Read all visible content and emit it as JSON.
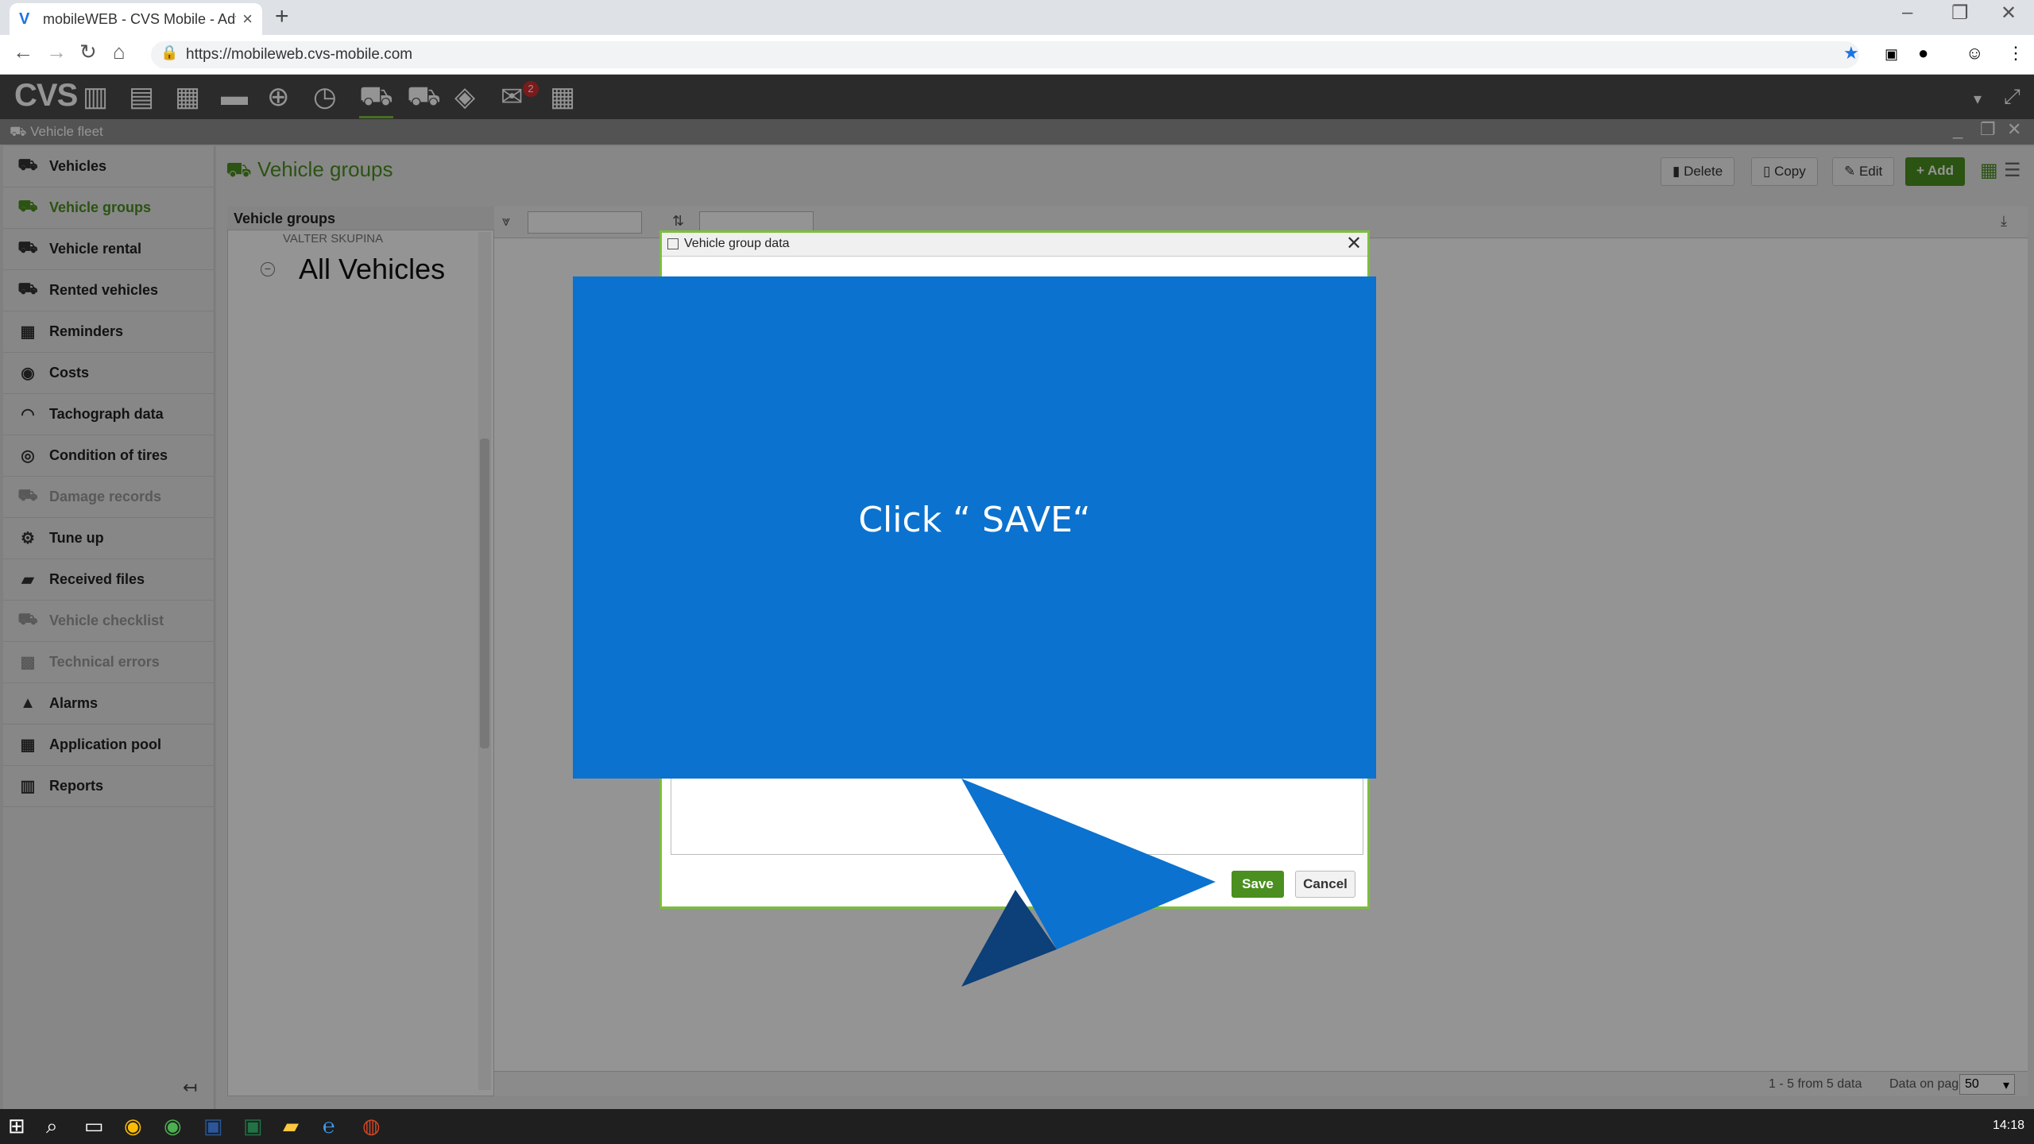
{
  "browser": {
    "tab_title": "mobileWEB - CVS Mobile - Adva",
    "new_tab": "+",
    "url": "https://mobileweb.cvs-mobile.com",
    "window_controls": [
      "–",
      "❐",
      "✕"
    ]
  },
  "app": {
    "logo": "CVS",
    "notification_count": "2",
    "module_title": "Vehicle fleet"
  },
  "sidebar": {
    "items": [
      {
        "label": "Vehicles",
        "icon": "car-icon"
      },
      {
        "label": "Vehicle groups",
        "icon": "vehicle-groups-icon"
      },
      {
        "label": "Vehicle rental",
        "icon": "vehicle-rental-icon"
      },
      {
        "label": "Rented vehicles",
        "icon": "rented-vehicles-icon"
      },
      {
        "label": "Reminders",
        "icon": "calendar-icon"
      },
      {
        "label": "Costs",
        "icon": "coin-icon"
      },
      {
        "label": "Tachograph data",
        "icon": "tachograph-icon"
      },
      {
        "label": "Condition of tires",
        "icon": "tire-icon"
      },
      {
        "label": "Damage records",
        "icon": "damage-icon"
      },
      {
        "label": "Tune up",
        "icon": "tune-up-icon"
      },
      {
        "label": "Received files",
        "icon": "folder-icon"
      },
      {
        "label": "Vehicle checklist",
        "icon": "checklist-icon"
      },
      {
        "label": "Technical errors",
        "icon": "engine-icon"
      },
      {
        "label": "Alarms",
        "icon": "bell-icon"
      },
      {
        "label": "Application pool",
        "icon": "grid-icon"
      },
      {
        "label": "Reports",
        "icon": "bar-chart-icon"
      }
    ]
  },
  "main": {
    "page_title": "Vehicle groups",
    "actions": {
      "delete": "Delete",
      "copy": "Copy",
      "edit": "Edit",
      "add": "+ Add"
    },
    "tree": {
      "header": "Vehicle groups",
      "sub_item": "VALTER SKUPINA",
      "root_item": "All Vehicles"
    },
    "status": {
      "summary": "1 - 5 from 5 data",
      "page_size_label": "Data on page:",
      "page_size": "50"
    }
  },
  "dialog": {
    "title": "Vehicle group data",
    "save_label": "Save",
    "cancel_label": "Cancel"
  },
  "tutorial": {
    "instruction": "Click “ SAVE“"
  },
  "taskbar": {
    "clock": "14:18"
  },
  "colors": {
    "accent_green": "#4a8f1f",
    "callout_blue": "#0b72cf",
    "arrow_dark": "#0d3f78"
  }
}
